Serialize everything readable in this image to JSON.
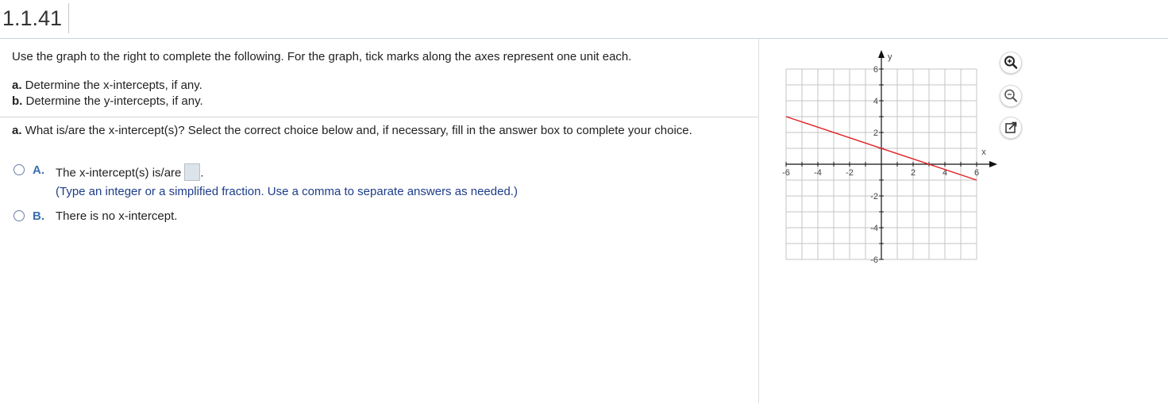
{
  "header": {
    "problem_number": "1.1.41"
  },
  "question": {
    "intro": "Use the graph to the right to complete the following. For the graph, tick marks along the axes represent one unit each.",
    "part_a_label": "a.",
    "part_a_text": " Determine the x-intercepts, if any.",
    "part_b_label": "b.",
    "part_b_text": " Determine the y-intercepts, if any.",
    "prompt_label": "a.",
    "prompt_text": " What is/are the x-intercept(s)? Select the correct choice below and, if necessary, fill in the answer box to complete your choice."
  },
  "choices": [
    {
      "letter": "A.",
      "text": "The x-intercept(s) is/are",
      "after_box": ".",
      "hint": "(Type an integer or a simplified fraction. Use a comma to separate answers as needed.)"
    },
    {
      "letter": "B.",
      "text": "There is no x-intercept."
    }
  ],
  "tools": [
    "zoom-in-icon",
    "zoom-out-icon",
    "popout-icon"
  ],
  "chart_data": {
    "type": "line",
    "xlabel": "x",
    "ylabel": "y",
    "xlim": [
      -6,
      6
    ],
    "ylim": [
      -6,
      6
    ],
    "x_ticks": [
      "-6",
      "-4",
      "-2",
      "2",
      "4",
      "6"
    ],
    "y_ticks": [
      "6",
      "4",
      "2",
      "-2",
      "-4",
      "-6"
    ],
    "grid": true,
    "series": [
      {
        "x": [
          -6,
          6
        ],
        "y": [
          3,
          -1
        ],
        "color": "#e02020"
      }
    ]
  }
}
